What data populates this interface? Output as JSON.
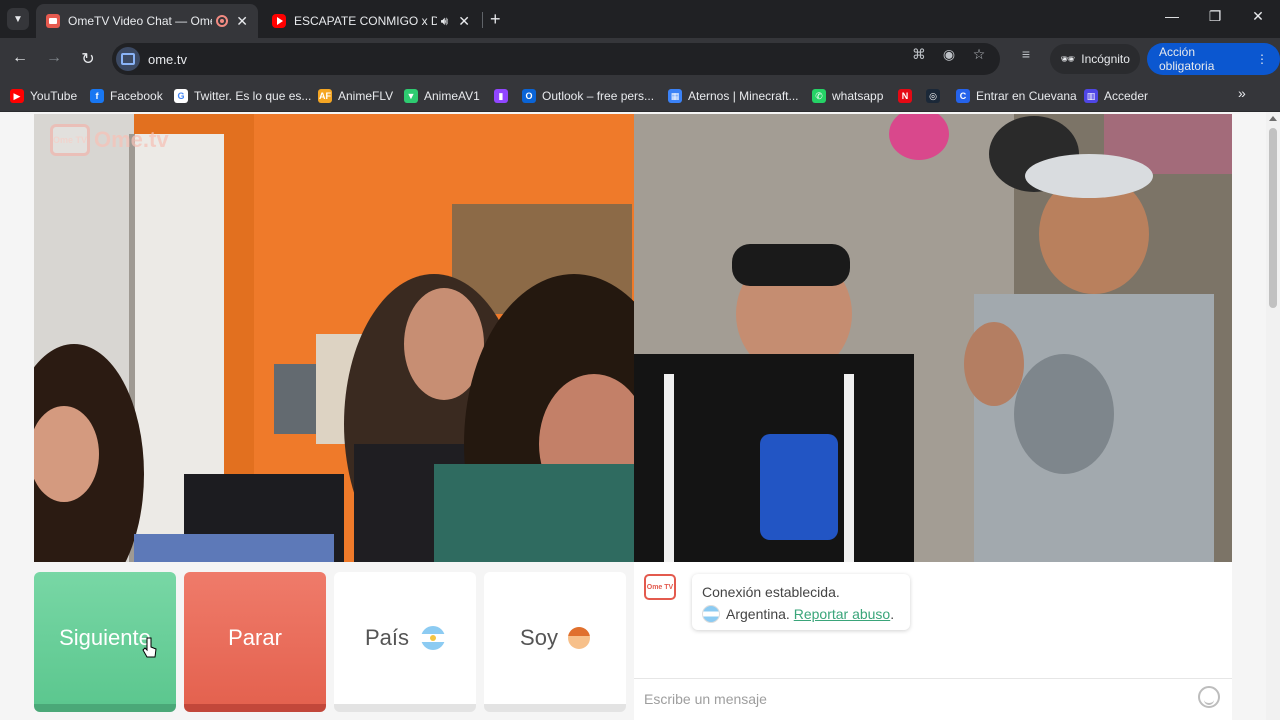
{
  "browser": {
    "tabs": [
      {
        "title": "OmeTV Video Chat — Ome",
        "active": true,
        "recording": true
      },
      {
        "title": "ESCAPATE CONMIGO x Dj B",
        "active": false,
        "audio": true
      }
    ],
    "url": "ome.tv",
    "incognito_label": "Incógnito",
    "required_action_label": "Acción obligatoria",
    "bookmarks": [
      {
        "label": "YouTube",
        "icon": "youtube-icon",
        "color": "#ff0000"
      },
      {
        "label": "Facebook",
        "icon": "facebook-icon",
        "color": "#1877f2"
      },
      {
        "label": "Twitter. Es lo que es...",
        "icon": "google-icon",
        "color": "#ffffff"
      },
      {
        "label": "AnimeFLV",
        "icon": "animeflv-icon",
        "color": "#f5a623"
      },
      {
        "label": "AnimeAV1",
        "icon": "animeav1-icon",
        "color": "#2ecc71"
      },
      {
        "label": "",
        "icon": "twitch-icon",
        "color": "#9146ff"
      },
      {
        "label": "Outlook – free pers...",
        "icon": "outlook-icon",
        "color": "#0a64d6"
      },
      {
        "label": "Aternos | Minecraft...",
        "icon": "aternos-icon",
        "color": "#3b82f6"
      },
      {
        "label": "whatsapp",
        "icon": "whatsapp-icon",
        "color": "#25d366"
      },
      {
        "label": "",
        "icon": "netflix-icon",
        "color": "#e50914"
      },
      {
        "label": "",
        "icon": "steam-icon",
        "color": "#1b2838"
      },
      {
        "label": "Entrar en Cuevana",
        "icon": "cuevana-icon",
        "color": "#2563eb"
      },
      {
        "label": "Acceder",
        "icon": "acceder-icon",
        "color": "#4f46e5"
      }
    ]
  },
  "page": {
    "logo_text": "Ome.tv",
    "logo_badge": "Ome TV",
    "controls": {
      "next_label": "Siguiente",
      "stop_label": "Parar",
      "country_label": "País",
      "gender_label": "Soy"
    },
    "chat": {
      "status": "Conexión establecida.",
      "country": "Argentina.",
      "report_link": "Reportar abuso",
      "report_suffix": ".",
      "input_placeholder": "Escribe un mensaje"
    }
  }
}
